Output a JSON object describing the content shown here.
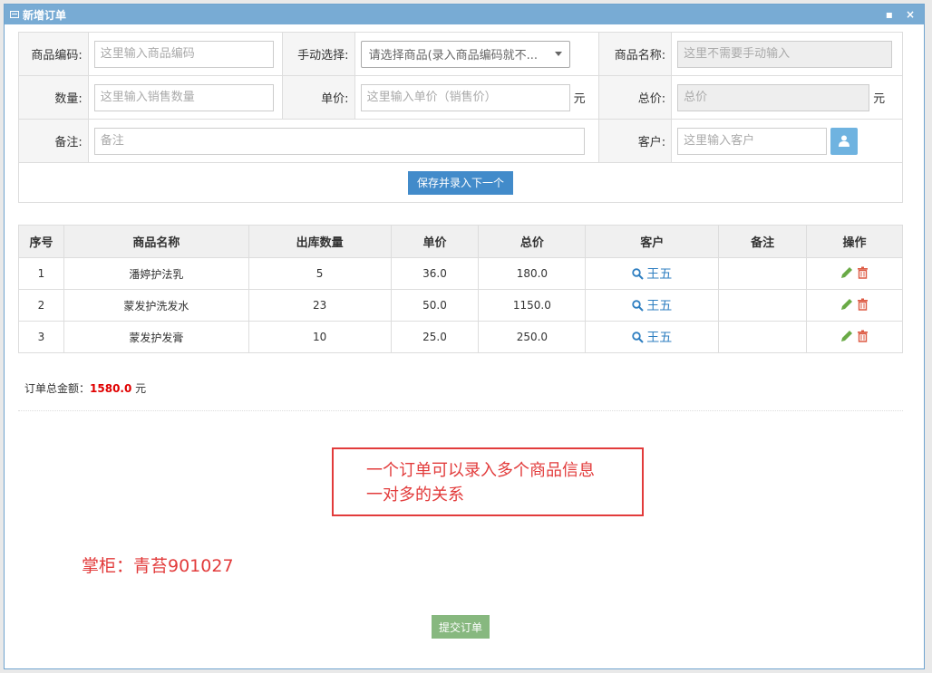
{
  "window": {
    "title": "新增订单",
    "minimize": "▪",
    "close": "×"
  },
  "form": {
    "code_label": "商品编码:",
    "code_placeholder": "这里输入商品编码",
    "manual_label": "手动选择:",
    "manual_value": "请选择商品(录入商品编码就不...",
    "name_label": "商品名称:",
    "name_placeholder": "这里不需要手动输入",
    "qty_label": "数量:",
    "qty_placeholder": "这里输入销售数量",
    "price_label": "单价:",
    "price_placeholder": "这里输入单价（销售价）",
    "price_unit": "元",
    "total_label": "总价:",
    "total_placeholder": "总价",
    "total_unit": "元",
    "remark_label": "备注:",
    "remark_placeholder": "备注",
    "customer_label": "客户:",
    "customer_placeholder": "这里输入客户",
    "save_next": "保存并录入下一个"
  },
  "table": {
    "headers": [
      "序号",
      "商品名称",
      "出库数量",
      "单价",
      "总价",
      "客户",
      "备注",
      "操作"
    ],
    "rows": [
      {
        "no": "1",
        "name": "潘婷护法乳",
        "qty": "5",
        "price": "36.0",
        "total": "180.0",
        "customer": "王五",
        "remark": ""
      },
      {
        "no": "2",
        "name": "蒙发护洗发水",
        "qty": "23",
        "price": "50.0",
        "total": "1150.0",
        "customer": "王五",
        "remark": ""
      },
      {
        "no": "3",
        "name": "蒙发护发膏",
        "qty": "10",
        "price": "25.0",
        "total": "250.0",
        "customer": "王五",
        "remark": ""
      }
    ]
  },
  "summary": {
    "label": "订单总金额：",
    "amount": "1580.0",
    "unit": " 元"
  },
  "annotation": {
    "line1": "一个订单可以录入多个商品信息",
    "line2": "一对多的关系"
  },
  "signature": "掌柜：青苔901027",
  "submit": "提交订单",
  "colors": {
    "accent": "#428bca",
    "title_bar": "#78abd4",
    "danger": "#e23b3b",
    "submit": "#87b87f"
  }
}
